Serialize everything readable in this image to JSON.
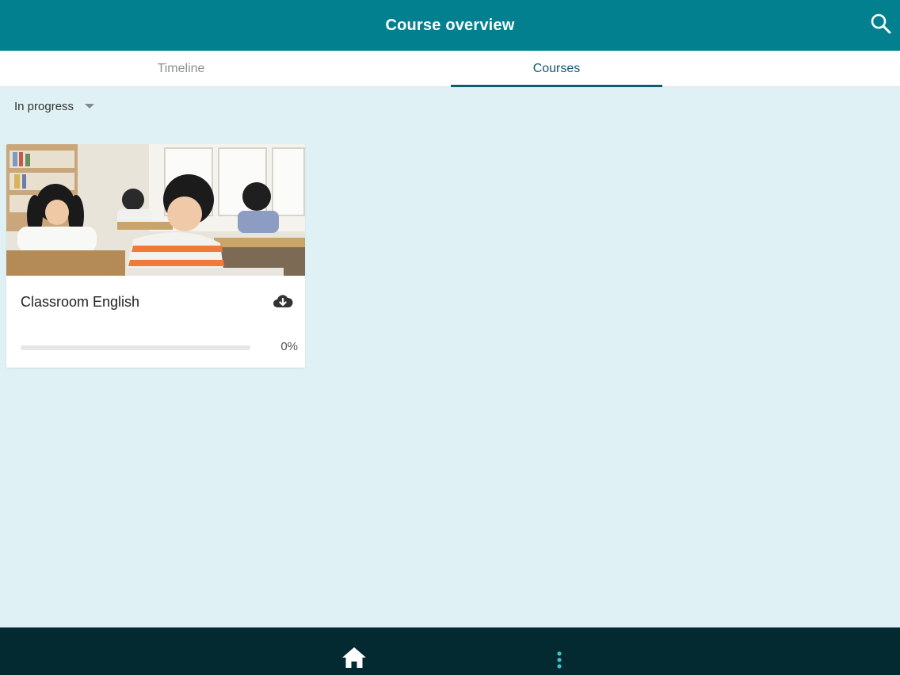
{
  "header": {
    "title": "Course overview",
    "search_icon": "search-icon",
    "color": "#028090"
  },
  "tabs": [
    {
      "label": "Timeline",
      "active": false
    },
    {
      "label": "Courses",
      "active": true
    }
  ],
  "filter": {
    "selected": "In progress",
    "icon": "caret-down-icon"
  },
  "courses": [
    {
      "name": "Classroom English",
      "image": "classroom-photo",
      "download_icon": "cloud-download-icon",
      "progress": 0,
      "progress_label": "0%"
    }
  ],
  "bottom_nav": {
    "items": [
      {
        "icon": "home-icon"
      },
      {
        "icon": "more-vertical-icon",
        "color": "#3bc3c9"
      }
    ],
    "background": "#022a30"
  }
}
